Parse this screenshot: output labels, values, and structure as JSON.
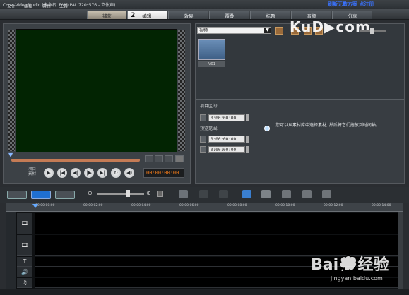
{
  "titlebar": {
    "title": "Corel VideoStudio (未命名, DVD PAL 720*576 - 立体声)",
    "right_text": "刷新无数方案 点注册"
  },
  "menu": [
    "文件",
    "编辑",
    "素材",
    "工具"
  ],
  "steps": {
    "capture": "捕获",
    "edit_num": "2",
    "edit": "编辑",
    "effect": "效果",
    "overlay": "覆叠",
    "title": "标题",
    "audio": "音频",
    "share": "分享"
  },
  "preview": {
    "ctrl_label": "项目 素材",
    "timecode": "00:00:00:00",
    "buttons": [
      "▶",
      "|◀",
      "◀|",
      "|▶",
      "▶|",
      "↻",
      "◀)"
    ]
  },
  "library": {
    "dropdown": "视频",
    "thumb_caption": "V01",
    "icons": [
      "📁",
      "↹",
      "▭",
      "▭"
    ]
  },
  "properties": {
    "project_label": "项目区间:",
    "project_tc": "0:00:00:00",
    "preview_label": "预览范围:",
    "preview_start": "0:00:00:00",
    "preview_end": "0:00:00:00",
    "hint": "您可以从素材库中选择素材, 然后将它们拖放到时间轴。"
  },
  "timeline": {
    "ticks": [
      "00:00:00:00",
      "00:00:02:00",
      "00:00:04:00",
      "00:00:06:00",
      "00:00:08:00",
      "00:00:10:00",
      "00:00:12:00",
      "00:00:14:00"
    ],
    "track_icons": [
      "🎞",
      "🎞",
      "T",
      "🔊",
      "♫"
    ]
  },
  "watermarks": {
    "kudou": "KuD▶com",
    "baidu": "Bai💭经验",
    "baidu_sub": "jingyan.baidu.com"
  },
  "colors": {
    "accent_blue": "#1f6fd0",
    "timecode_orange": "#f07a1a",
    "screen_green": "#022402"
  }
}
